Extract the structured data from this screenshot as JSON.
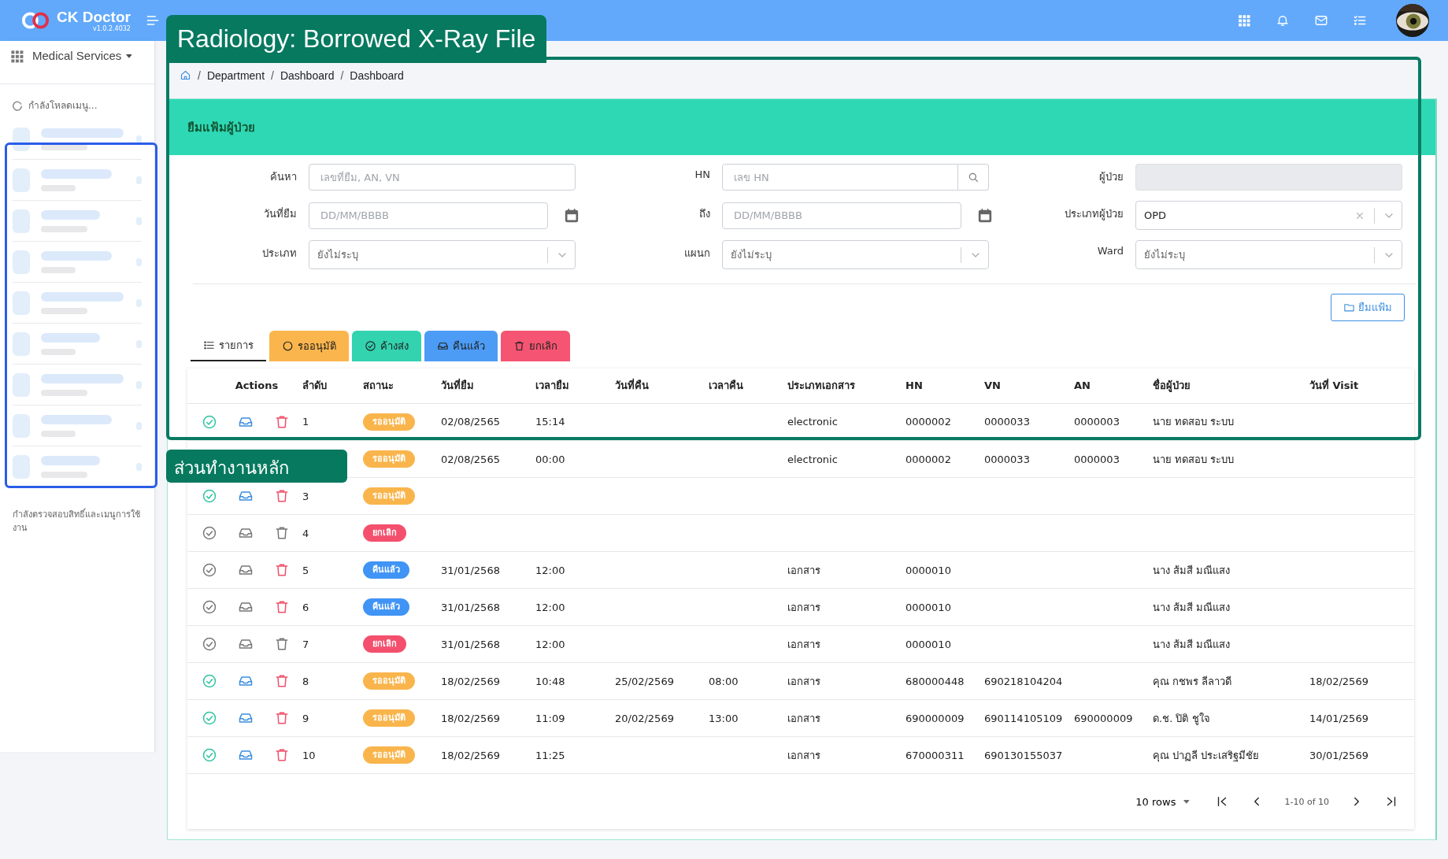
{
  "app": {
    "name": "CK Doctor",
    "version": "v1.0.2.4032"
  },
  "sidebar": {
    "module": "Medical Services",
    "loading_text": "กำลังโหลดเมนู...",
    "footer_text": "กำลังตรวจสอบสิทธิ์และเมนูการใช้งาน"
  },
  "annotations": {
    "title_label": "Radiology: Borrowed X-Ray File",
    "section_label": "ส่วนทำงานหลัก"
  },
  "breadcrumb": {
    "separator": "/",
    "items": [
      "Department",
      "Dashboard",
      "Dashboard"
    ]
  },
  "panel_title": "ยืมแฟ้มผู้ป่วย",
  "filters": [
    {
      "label": "ค้นหา",
      "kind": "text",
      "placeholder": "เลขที่ยืม, AN, VN"
    },
    {
      "label": "HN",
      "kind": "search",
      "placeholder": "เลข HN"
    },
    {
      "label": "ผู้ป่วย",
      "kind": "readonly"
    },
    {
      "label": "วันที่ยืม",
      "kind": "date",
      "placeholder": "DD/MM/BBBB"
    },
    {
      "label": "ถึง",
      "kind": "date",
      "placeholder": "DD/MM/BBBB"
    },
    {
      "label": "ประเภทผู้ป่วย",
      "kind": "select",
      "value": "OPD",
      "clearable": true
    },
    {
      "label": "ประเภท",
      "kind": "select",
      "placeholder": "ยังไม่ระบุ",
      "clearable": false
    },
    {
      "label": "แผนก",
      "kind": "select",
      "placeholder": "ยังไม่ระบุ",
      "clearable": false
    },
    {
      "label": "Ward",
      "kind": "select",
      "placeholder": "ยังไม่ระบุ",
      "clearable": false
    }
  ],
  "borrow_button": "ยืมแฟ้ม",
  "tabs": [
    {
      "label": "รายการ",
      "kind": "list",
      "selected": true
    },
    {
      "label": "รออนุมัติ",
      "kind": "circle",
      "selected": false,
      "color": "#fbb54d"
    },
    {
      "label": "ค้างส่ง",
      "kind": "check",
      "selected": false,
      "color": "#33d3b0"
    },
    {
      "label": "คืนแล้ว",
      "kind": "inbox",
      "selected": false,
      "color": "#4c9cf6"
    },
    {
      "label": "ยกเลิก",
      "kind": "trash",
      "selected": false,
      "color": "#f55572"
    }
  ],
  "table": {
    "columns": [
      "Actions",
      "ลำดับ",
      "สถานะ",
      "วันที่ยืม",
      "เวลายืม",
      "วันที่คืน",
      "เวลาคืน",
      "ประเภทเอกสาร",
      "HN",
      "VN",
      "AN",
      "ชื่อผู้ป่วย",
      "วันที่ Visit"
    ],
    "rows": [
      {
        "actions": {
          "approve": true,
          "return": true,
          "delete": true
        },
        "seq": "1",
        "status": {
          "label": "รออนุมัติ",
          "kind": "pending"
        },
        "borrow_date": "02/08/2565",
        "borrow_time": "15:14",
        "doc_type": "electronic",
        "hn": "0000002",
        "vn": "0000033",
        "an": "0000003",
        "patient": "นาย ทดสอบ ระบบ"
      },
      {
        "status": {
          "label": "รออนุมัติ",
          "kind": "pending"
        },
        "borrow_date": "02/08/2565",
        "borrow_time": "00:00",
        "doc_type": "electronic",
        "hn": "0000002",
        "vn": "0000033",
        "an": "0000003",
        "patient": "นาย ทดสอบ ระบบ"
      },
      {
        "actions": {
          "approve": true,
          "return": true,
          "delete": true
        },
        "seq": "3",
        "status": {
          "label": "รออนุมัติ",
          "kind": "pending"
        }
      },
      {
        "actions": {
          "approve": false,
          "return": false,
          "delete": false
        },
        "seq": "4",
        "status": {
          "label": "ยกเลิก",
          "kind": "cancelled"
        }
      },
      {
        "actions": {
          "approve": false,
          "return": false,
          "delete": true
        },
        "seq": "5",
        "status": {
          "label": "คืนแล้ว",
          "kind": "returned"
        },
        "borrow_date": "31/01/2568",
        "borrow_time": "12:00",
        "doc_type": "เอกสาร",
        "hn": "0000010",
        "patient": "นาง ส้มสี มณีแสง"
      },
      {
        "actions": {
          "approve": false,
          "return": false,
          "delete": true
        },
        "seq": "6",
        "status": {
          "label": "คืนแล้ว",
          "kind": "returned"
        },
        "borrow_date": "31/01/2568",
        "borrow_time": "12:00",
        "doc_type": "เอกสาร",
        "hn": "0000010",
        "patient": "นาง ส้มสี มณีแสง"
      },
      {
        "actions": {
          "approve": false,
          "return": false,
          "delete": false
        },
        "seq": "7",
        "status": {
          "label": "ยกเลิก",
          "kind": "cancelled"
        },
        "borrow_date": "31/01/2568",
        "borrow_time": "12:00",
        "doc_type": "เอกสาร",
        "hn": "0000010",
        "patient": "นาง ส้มสี มณีแสง"
      },
      {
        "actions": {
          "approve": true,
          "return": true,
          "delete": true
        },
        "seq": "8",
        "status": {
          "label": "รออนุมัติ",
          "kind": "pending"
        },
        "borrow_date": "18/02/2569",
        "borrow_time": "10:48",
        "return_date": "25/02/2569",
        "return_time": "08:00",
        "doc_type": "เอกสาร",
        "hn": "680000448",
        "vn": "690218104204",
        "patient": "คุณ กชพร ลีลาวดี",
        "visit_date": "18/02/2569"
      },
      {
        "actions": {
          "approve": true,
          "return": true,
          "delete": true
        },
        "seq": "9",
        "status": {
          "label": "รออนุมัติ",
          "kind": "pending"
        },
        "borrow_date": "18/02/2569",
        "borrow_time": "11:09",
        "return_date": "20/02/2569",
        "return_time": "13:00",
        "doc_type": "เอกสาร",
        "hn": "690000009",
        "vn": "690114105109",
        "an": "690000009",
        "patient": "ด.ช. ปิติ ชูใจ",
        "visit_date": "14/01/2569"
      },
      {
        "actions": {
          "approve": true,
          "return": true,
          "delete": true
        },
        "seq": "10",
        "status": {
          "label": "รออนุมัติ",
          "kind": "pending"
        },
        "borrow_date": "18/02/2569",
        "borrow_time": "11:25",
        "doc_type": "เอกสาร",
        "hn": "670000311",
        "vn": "690130155037",
        "patient": "คุณ ปาฏลี ประเสริฐมีชัย",
        "visit_date": "30/01/2569"
      }
    ]
  },
  "pagination": {
    "rows_per_page": "10 rows",
    "range": "1-10 of 10"
  }
}
